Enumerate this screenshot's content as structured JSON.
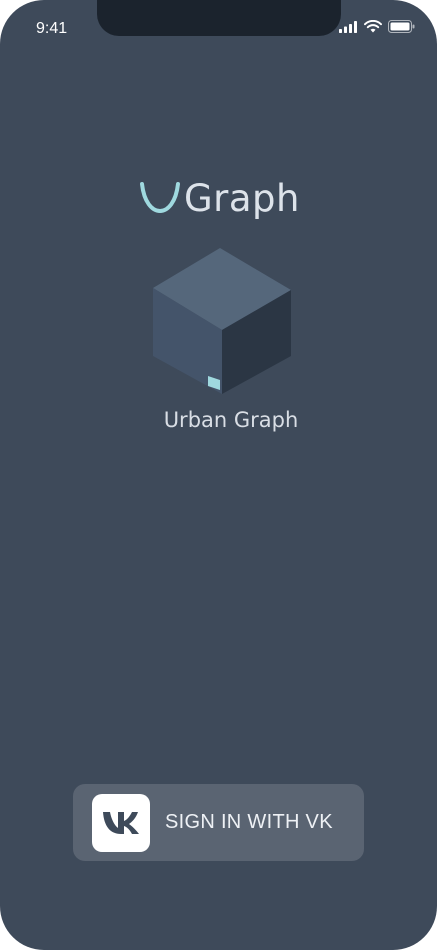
{
  "status_bar": {
    "time": "9:41",
    "signal_icon": "cellular-signal-icon",
    "wifi_icon": "wifi-icon",
    "battery_icon": "battery-icon"
  },
  "logo": {
    "text": "Graph",
    "mark_icon": "u-arc-logo-icon",
    "mark_color": "#9fd9df"
  },
  "illustration": {
    "icon": "cube-icon",
    "caption": "Urban Graph"
  },
  "signin": {
    "label": "SIGN IN WITH VK",
    "icon": "vk-logo-icon"
  },
  "colors": {
    "background": "#3e4a5a",
    "button": "#5a6472",
    "accent": "#9fd9df"
  }
}
